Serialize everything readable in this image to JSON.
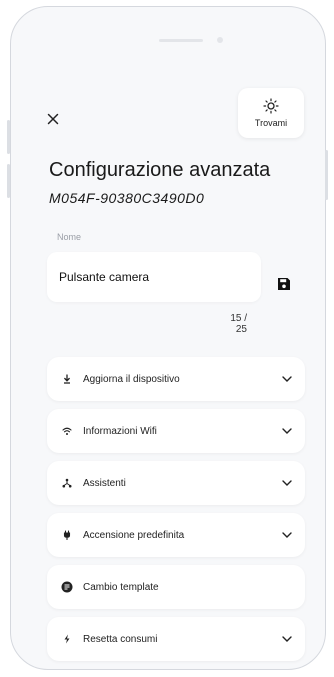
{
  "header": {
    "find_label": "Trovami",
    "find_icon": "sun-icon",
    "close_icon": "close-icon"
  },
  "page": {
    "title": "Configurazione avanzata",
    "device_id": "M054F-90380C3490D0"
  },
  "name_field": {
    "label": "Nome",
    "value": "Pulsante camera",
    "counter": "15 / 25",
    "save_icon": "floppy-disk-icon"
  },
  "menu": {
    "items": [
      {
        "label": "Aggiorna il dispositivo",
        "icon": "download-icon",
        "expandable": true
      },
      {
        "label": "Informazioni Wifi",
        "icon": "wifi-icon",
        "expandable": true
      },
      {
        "label": "Assistenti",
        "icon": "network-icon",
        "expandable": true
      },
      {
        "label": "Accensione predefinita",
        "icon": "plug-icon",
        "expandable": true
      },
      {
        "label": "Cambio template",
        "icon": "template-icon",
        "expandable": false
      },
      {
        "label": "Resetta consumi",
        "icon": "bolt-icon",
        "expandable": true
      }
    ]
  },
  "colors": {
    "background": "#f7f8fa",
    "card": "#ffffff",
    "text": "#1a1a1a",
    "muted": "#9a9ea6"
  }
}
